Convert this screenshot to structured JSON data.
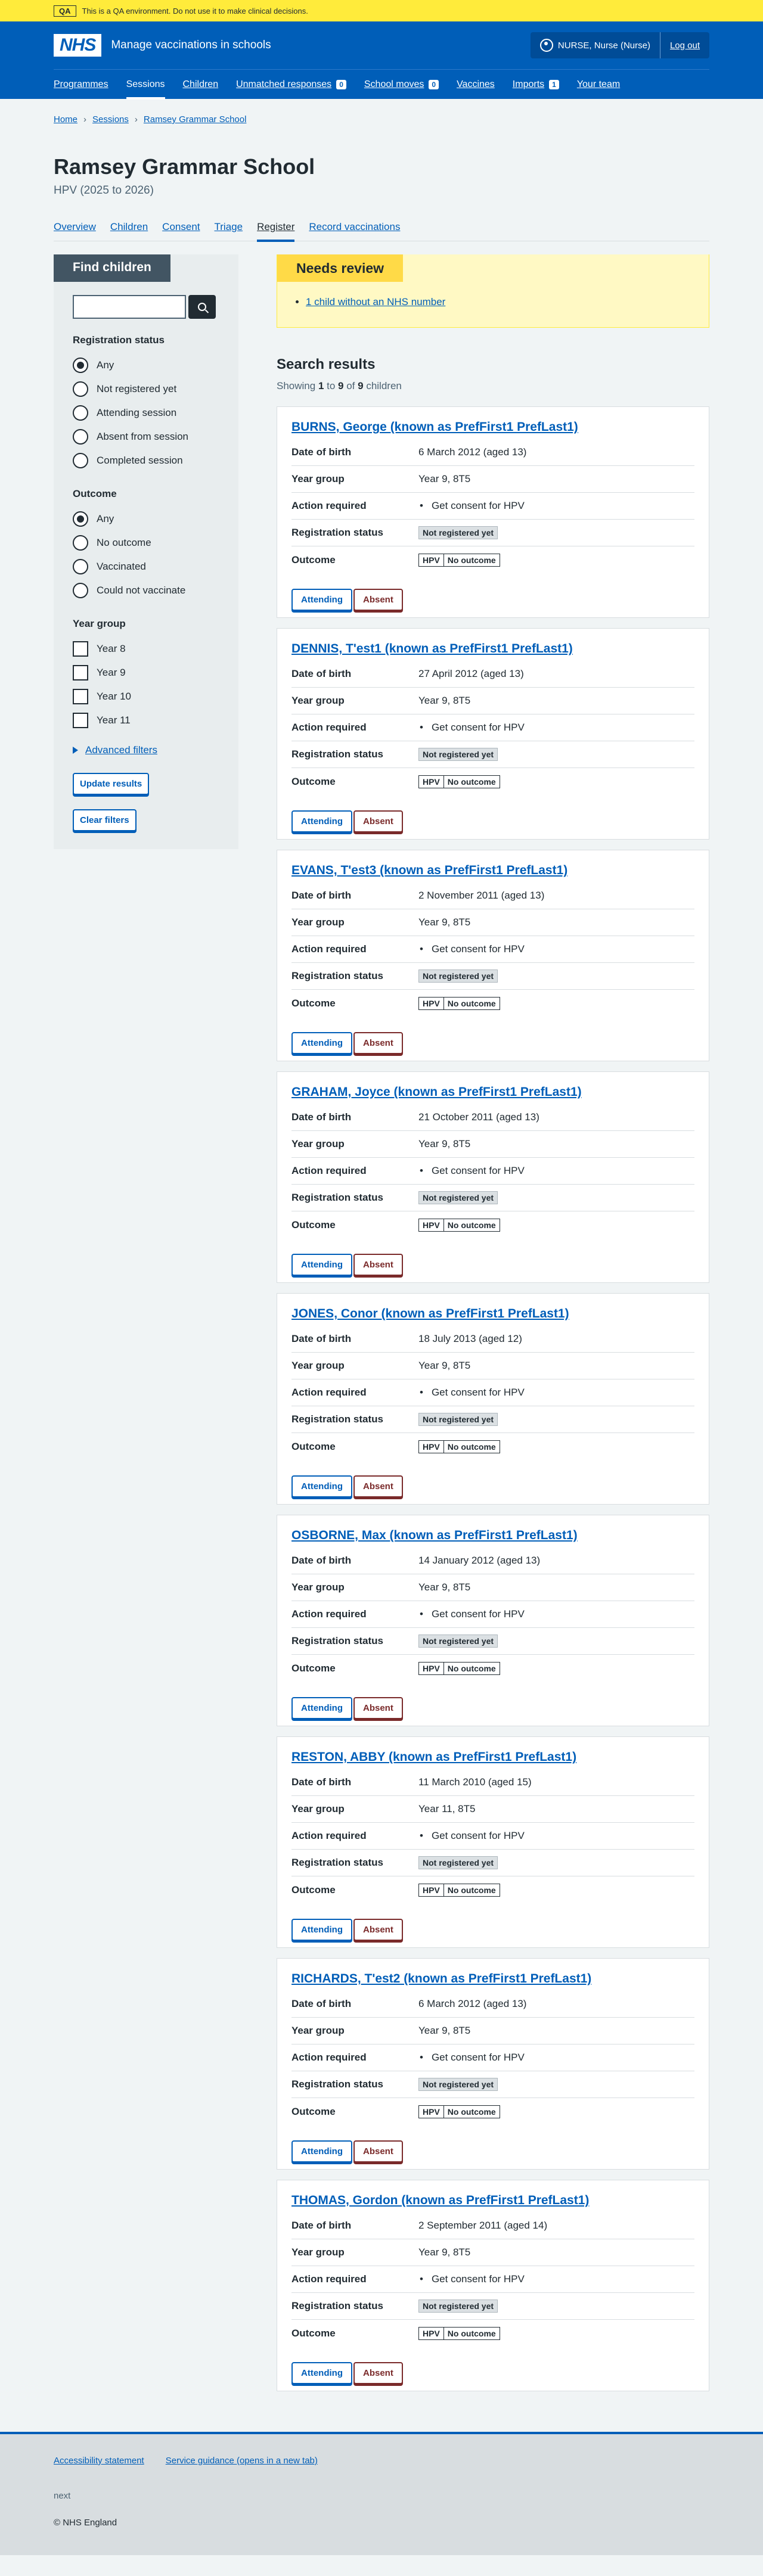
{
  "env_banner": {
    "tag": "QA",
    "text": "This is a QA environment. Do not use it to make clinical decisions."
  },
  "header": {
    "logo": "NHS",
    "service_name": "Manage vaccinations in schools",
    "user": "NURSE, Nurse (Nurse)",
    "logout": "Log out",
    "nav": [
      {
        "label": "Programmes"
      },
      {
        "label": "Sessions",
        "active": true
      },
      {
        "label": "Children"
      },
      {
        "label": "Unmatched responses",
        "count": "0"
      },
      {
        "label": "School moves",
        "count": "0"
      },
      {
        "label": "Vaccines"
      },
      {
        "label": "Imports",
        "count": "1"
      },
      {
        "label": "Your team"
      }
    ]
  },
  "breadcrumb": [
    "Home",
    "Sessions",
    "Ramsey Grammar School"
  ],
  "page": {
    "title": "Ramsey Grammar School",
    "caption": "HPV (2025 to 2026)"
  },
  "tabs": [
    "Overview",
    "Children",
    "Consent",
    "Triage",
    "Register",
    "Record vaccinations"
  ],
  "filters": {
    "title": "Find children",
    "registration_status": {
      "legend": "Registration status",
      "options": [
        "Any",
        "Not registered yet",
        "Attending session",
        "Absent from session",
        "Completed session"
      ],
      "selected": "Any"
    },
    "outcome": {
      "legend": "Outcome",
      "options": [
        "Any",
        "No outcome",
        "Vaccinated",
        "Could not vaccinate"
      ],
      "selected": "Any"
    },
    "year_group": {
      "legend": "Year group",
      "options": [
        "Year 8",
        "Year 9",
        "Year 10",
        "Year 11"
      ]
    },
    "advanced": "Advanced filters",
    "update": "Update results",
    "clear": "Clear filters"
  },
  "needs_review": {
    "label": "Needs review",
    "item": "1 child without an NHS number"
  },
  "results": {
    "title": "Search results",
    "showing_prefix": "Showing ",
    "from": "1",
    "to_word": " to ",
    "to": "9",
    "of_word": " of ",
    "total": "9",
    "suffix": " children"
  },
  "labels": {
    "dob": "Date of birth",
    "year_group": "Year group",
    "action": "Action required",
    "reg_status": "Registration status",
    "outcome": "Outcome",
    "attending": "Attending",
    "absent": "Absent"
  },
  "children": [
    {
      "name": "BURNS, George (known as PrefFirst1 PrefLast1)",
      "dob": "6 March 2012 (aged 13)",
      "year_group": "Year 9, 8T5",
      "action": "Get consent for HPV",
      "reg_status": "Not registered yet",
      "outcome_prog": "HPV",
      "outcome": "No outcome"
    },
    {
      "name": "DENNIS, T'est1 (known as PrefFirst1 PrefLast1)",
      "dob": "27 April 2012 (aged 13)",
      "year_group": "Year 9, 8T5",
      "action": "Get consent for HPV",
      "reg_status": "Not registered yet",
      "outcome_prog": "HPV",
      "outcome": "No outcome"
    },
    {
      "name": "EVANS, T'est3 (known as PrefFirst1 PrefLast1)",
      "dob": "2 November 2011 (aged 13)",
      "year_group": "Year 9, 8T5",
      "action": "Get consent for HPV",
      "reg_status": "Not registered yet",
      "outcome_prog": "HPV",
      "outcome": "No outcome"
    },
    {
      "name": "GRAHAM, Joyce (known as PrefFirst1 PrefLast1)",
      "dob": "21 October 2011 (aged 13)",
      "year_group": "Year 9, 8T5",
      "action": "Get consent for HPV",
      "reg_status": "Not registered yet",
      "outcome_prog": "HPV",
      "outcome": "No outcome"
    },
    {
      "name": "JONES, Conor (known as PrefFirst1 PrefLast1)",
      "dob": "18 July 2013 (aged 12)",
      "year_group": "Year 9, 8T5",
      "action": "Get consent for HPV",
      "reg_status": "Not registered yet",
      "outcome_prog": "HPV",
      "outcome": "No outcome"
    },
    {
      "name": "OSBORNE, Max (known as PrefFirst1 PrefLast1)",
      "dob": "14 January 2012 (aged 13)",
      "year_group": "Year 9, 8T5",
      "action": "Get consent for HPV",
      "reg_status": "Not registered yet",
      "outcome_prog": "HPV",
      "outcome": "No outcome"
    },
    {
      "name": "RESTON, ABBY (known as PrefFirst1 PrefLast1)",
      "dob": "11 March 2010 (aged 15)",
      "year_group": "Year 11, 8T5",
      "action": "Get consent for HPV",
      "reg_status": "Not registered yet",
      "outcome_prog": "HPV",
      "outcome": "No outcome"
    },
    {
      "name": "RICHARDS, T'est2 (known as PrefFirst1 PrefLast1)",
      "dob": "6 March 2012 (aged 13)",
      "year_group": "Year 9, 8T5",
      "action": "Get consent for HPV",
      "reg_status": "Not registered yet",
      "outcome_prog": "HPV",
      "outcome": "No outcome"
    },
    {
      "name": "THOMAS, Gordon (known as PrefFirst1 PrefLast1)",
      "dob": "2 September 2011 (aged 14)",
      "year_group": "Year 9, 8T5",
      "action": "Get consent for HPV",
      "reg_status": "Not registered yet",
      "outcome_prog": "HPV",
      "outcome": "No outcome"
    }
  ],
  "footer": {
    "links": [
      "Accessibility statement",
      "Service guidance (opens in a new tab)"
    ],
    "next": "next",
    "copyright": "© NHS England"
  },
  "colors": {
    "brand": "#005eb8",
    "banner": "#ffeb3b",
    "needs_review": "#fff9c4",
    "absent": "#7a2a2a"
  }
}
